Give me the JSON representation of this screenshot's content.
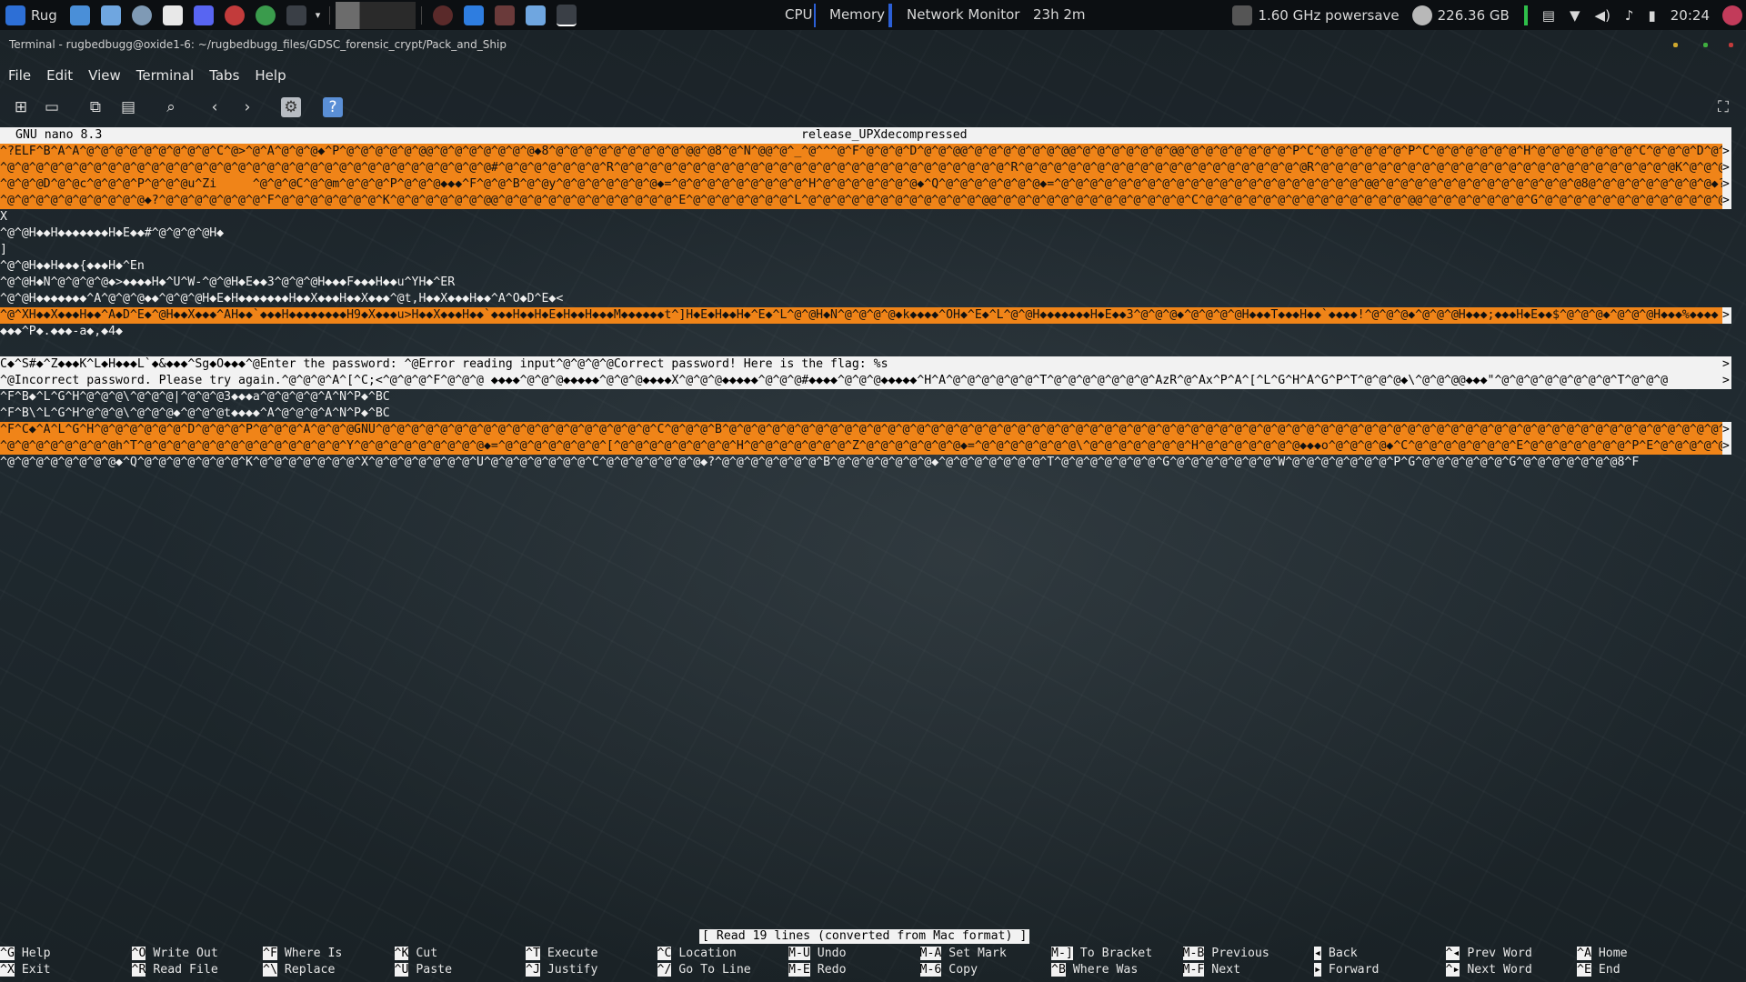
{
  "panel": {
    "app_label": "Rug",
    "cpu_label": "CPU",
    "memory_label": "Memory",
    "network_label": "Network Monitor",
    "uptime": "23h 2m",
    "cpu_freq": "1.60 GHz powersave",
    "disk_free": "226.36 GB",
    "clock": "20:24"
  },
  "window": {
    "title": "Terminal - rugbedbugg@oxide1-6: ~/rugbedbugg_files/GDSC_forensic_crypt/Pack_and_Ship"
  },
  "menu": [
    "File",
    "Edit",
    "View",
    "Terminal",
    "Tabs",
    "Help"
  ],
  "toolbar": {
    "icons": [
      "new-tab-icon",
      "new-window-icon",
      "copy-icon",
      "paste-icon",
      "search-icon",
      "previous-icon",
      "next-icon",
      "preferences-icon",
      "help-icon",
      "fullscreen-icon"
    ]
  },
  "nano": {
    "version": "GNU nano 8.3",
    "filename": "release_UPXdecompressed",
    "lines": [
      "^?ELF^B^A^A^@^@^@^@^@^@^@^@^@^C^@>^@^A^@^@^@◆^P^@^@^@^@^@^@@^@^@^@^@^@^@^@◆8^@^@^@^@^@^@^@^@^@^@@^@8^@^N^@@^@^_^@^^^@^F^@^@^@^D^@^@^@@^@^@^@^@^@^@^@@^@^@^@^@^@^@^@@^@^@^@^@^@^@^@^P^C^@^@^@^@^@^@^P^C^@^@^@^@^@^@^H^@^@^@^@^@^@^@^C^@^@^@^D^@^@^@",
      "^@^@^@^@^@^@^@^@^@^@^@^@^@^@^@^@^@^@^@^@^@^@^@^@^@^@^@^@^@^@^@^@^@^@#^@^@^@^@^@^@^@^R^@^@^@^@^@^@^@^@^@^@^@^@^@^@^@^@^@^@^@^@^@^@^@^@^@^@^@^R^@^@^@^@^@^@^@^@^@^@^@^@^@^@^@^@^@^@^@^@R^@^@^@^@^@^@^@^@^@^@^@^@^@^@^@^@^@^@^@^@^@^@^@^@^@K^@^@^@^R^@^@^@^@^@^@^@^@^@^@^@",
      "^@^@^@D^@^@c^@^@^@^P^@^@^@u^Zi     ^@^@^@C^@^@m^@^@^@^P^@^@^@◆◆◆^F^@^@^B^@^@y^@^@^@^@^@^@^@◆=^@^@^@^@^@^@^@^@^@^H^@^@^@^@^@^@^@◆^Q^@^@^@^@^@^@^@◆=^@^@^@^@^@^@^@^@^@^@^@^@^@^@^@^@^@^@^@^@^@^@@^@^@^@^@^@^@^@^@^@^@^@^@^@^@8@^@^@^@^@^@^@^@^@◆?^@^@^@^@^@^@^@^F^@^@^@",
      "^@^@^@^@^@^@^@^@^@^@◆?^@^@^@^@^@^@^@^F^@^@^@^@^@^@^@^K^@^@^@^@^@^@^@@^@^@^@^@^@^@^@^@^@^@^@^@^E^@^@^@^@^@^@^@^L^@^@^@^@^@^@^@^@^@^@^@^@^@@^@^@^@^@^@^@^@^@^@^@^@^@^@^C^@^@^@^@^@^@^@^@^@^@^@^@^@^@^@@^@^@^@^@^@^@^@^G^@^@^@^@^@^@^@^@^@^@^@^@^@^D^@^@^@^@^@^@^@^@^E^@^@^@",
      "X",
      "^@^@H◆◆H◆◆◆◆◆◆◆H◆E◆◆#^@^@^@^@H◆",
      "]",
      "^@^@H◆◆H◆◆◆{◆◆◆H◆^En",
      "^@^@H◆N^@^@^@^@◆>◆◆◆◆H◆^U^W-^@^@H◆E◆◆3^@^@^@H◆◆◆F◆◆◆H◆◆u^YH◆^ER",
      "^@^@H◆◆◆◆◆◆◆^A^@^@^@◆◆^@^@^@H◆E◆H◆◆◆◆◆◆◆H◆◆X◆◆◆H◆◆X◆◆◆^@t,H◆◆X◆◆◆H◆◆^A^O◆D^E◆<",
      "^@^XH◆◆X◆◆◆H◆◆^A◆D^E◆^@H◆◆X◆◆◆^AH◆◆`◆◆◆H◆◆◆◆◆◆◆◆H9◆X◆◆◆u>H◆◆X◆◆◆H◆◆`◆◆◆H◆◆H◆E◆H◆◆H◆◆◆M◆◆◆◆◆◆t^]H◆E◆H◆◆H◆^E◆^L^@^@H◆N^@^@^@^@◆k◆◆◆◆^OH◆^E◆^L^@^@H◆◆◆◆◆◆◆H◆E◆◆3^@^@^@◆^@^@^@^@H◆◆◆T◆◆◆H◆◆`◆◆◆◆!^@^@^@◆^@^@^@H◆◆◆;◆◆◆H◆E◆◆$^@^@^@◆^@^@^@H◆◆◆%◆◆◆◆",
      "◆◆◆^P◆.◆◆◆-a◆,◆4◆",
      "",
      "C◆^S#◆^Z◆◆◆K^L◆H◆◆◆L`◆&◆◆◆^Sg◆O◆◆◆^@Enter the password: ^@Error reading input^@^@^@^@Correct password! Here is the flag: %s",
      "^@Incorrect password. Please try again.^@^@^@^A^[^C;<^@^@^@^F^@^@^@ ◆◆◆◆^@^@^@◆◆◆◆◆^@^@^@◆◆◆◆X^@^@^@◆◆◆◆◆^@^@^@#◆◆◆◆^@^@^@◆◆◆◆◆^H^A^@^@^@^@^@^@^T^@^@^@^@^@^@^@^AzR^@^Ax^P^A^[^L^G^H^A^G^P^T^@^@^@◆\\^@^@^@@◆◆◆\"^@^@^@^@^@^@^@^@^T^@^@^@",
      "^F^B◆^L^G^H^@^@^@\\^@^@^@|^@^@^@3◆◆◆a^@^@^@^@^A^N^P◆^BC",
      "^F^B\\^L^G^H^@^@^@\\^@^@^@◆^@^@^@t◆◆◆◆^A^@^@^@^A^N^P◆^BC",
      "^F^C◆^A^L^G^H^@^@^@^@^@^@^D^@^@^@^P^@^@^@^A^@^@^@GNU^@^@^@^@^@^@^@^@^@^@^@^@^@^@^@^@^@^@^@^C^@^@^@^B^@^@^@^@^@^@^@^@^@^@^@^@^@^@^@^@^@^@^@^@^@^@^@^@^@^@^@^@^@^@^@^@^@^@^@^@^@^@^@^@^@^@^@^@^@^@^@^@^@^@^@^@^@^@^@^@^@^@^@^@^@^@^@^@^@^@^@^@^@^@",
      "^@^@^@^@^@^@^@^@h^T^@^@^@^@^@^@^@^@^@^@^@^@^@^@^Y^@^@^@^@^@^@^@^@^@◆=^@^@^@^@^@^@^@^[^@^@^@^@^@^@^@^@^H^@^@^@^@^@^@^@^Z^@^@^@^@^@^@^@◆=^@^@^@^@^@^@^@\\^@^@^@^@^@^@^@^H^@^@^@^@^@^@^@◆◆◆o^@^@^@^@◆^C^@^@^@^@^@^@^@^E^@^@^@^@^@^@^@^P^E^@^@^@^@^@^@^F^@^@^@^@^@^@^@◆^C^@^@^@",
      "^@^@^@^@^@^@^@^@◆^Q^@^@^@^@^@^@^@^K^@^@^@^@^@^@^@^X^@^@^@^@^@^@^@^U^@^@^@^@^@^@^@^C^@^@^@^@^@^@^@◆?^@^@^@^@^@^@^@^B^@^@^@^@^@^@^@◆^@^@^@^@^@^@^@^T^@^@^@^@^@^@^@^G^@^@^@^@^@^@^@^W^@^@^@^@^@^@^@^P^G^@^@^@^@^@^@^G^@^@^@^@^@^@^@8^F"
    ],
    "status": "[ Read 19 lines (converted from Mac format) ]",
    "shortcuts": [
      {
        "key": "^G",
        "label": "Help"
      },
      {
        "key": "^O",
        "label": "Write Out"
      },
      {
        "key": "^F",
        "label": "Where Is"
      },
      {
        "key": "^K",
        "label": "Cut"
      },
      {
        "key": "^T",
        "label": "Execute"
      },
      {
        "key": "^C",
        "label": "Location"
      },
      {
        "key": "M-U",
        "label": "Undo"
      },
      {
        "key": "M-A",
        "label": "Set Mark"
      },
      {
        "key": "M-]",
        "label": "To Bracket"
      },
      {
        "key": "M-B",
        "label": "Previous"
      },
      {
        "key": "◂",
        "label": "Back"
      },
      {
        "key": "^◂",
        "label": "Prev Word"
      },
      {
        "key": "^A",
        "label": "Home"
      },
      {
        "key": "^X",
        "label": "Exit"
      },
      {
        "key": "^R",
        "label": "Read File"
      },
      {
        "key": "^\\",
        "label": "Replace"
      },
      {
        "key": "^U",
        "label": "Paste"
      },
      {
        "key": "^J",
        "label": "Justify"
      },
      {
        "key": "^/",
        "label": "Go To Line"
      },
      {
        "key": "M-E",
        "label": "Redo"
      },
      {
        "key": "M-6",
        "label": "Copy"
      },
      {
        "key": "^B",
        "label": "Where Was"
      },
      {
        "key": "M-F",
        "label": "Next"
      },
      {
        "key": "▸",
        "label": "Forward"
      },
      {
        "key": "^▸",
        "label": "Next Word"
      },
      {
        "key": "^E",
        "label": "End"
      }
    ]
  }
}
